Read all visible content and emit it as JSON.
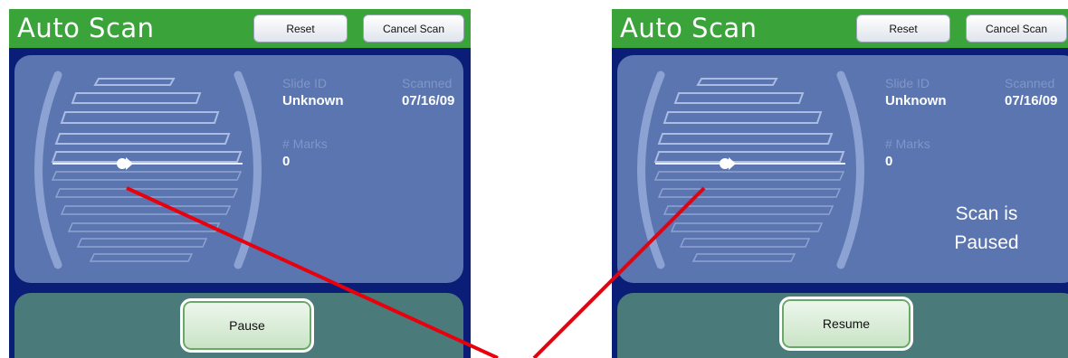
{
  "left_screen": {
    "title": "Auto Scan",
    "reset_label": "Reset",
    "cancel_label": "Cancel Scan",
    "slide_id_label": "Slide ID",
    "slide_id_value": "Unknown",
    "scanned_label": "Scanned",
    "scanned_value": "07/16/09",
    "marks_label": "# Marks",
    "marks_value": "0",
    "action_label": "Pause"
  },
  "right_screen": {
    "title": "Auto Scan",
    "reset_label": "Reset",
    "cancel_label": "Cancel Scan",
    "slide_id_label": "Slide ID",
    "slide_id_value": "Unknown",
    "scanned_label": "Scanned",
    "scanned_value": "07/16/09",
    "marks_label": "# Marks",
    "marks_value": "0",
    "status_line1": "Scan is",
    "status_line2": "Paused",
    "action_label": "Resume"
  },
  "colors": {
    "titlebar": "#3aa43a",
    "panel": "#5a75b0",
    "bottom_panel": "#4a7a7a",
    "annotation": "#e8000d"
  }
}
